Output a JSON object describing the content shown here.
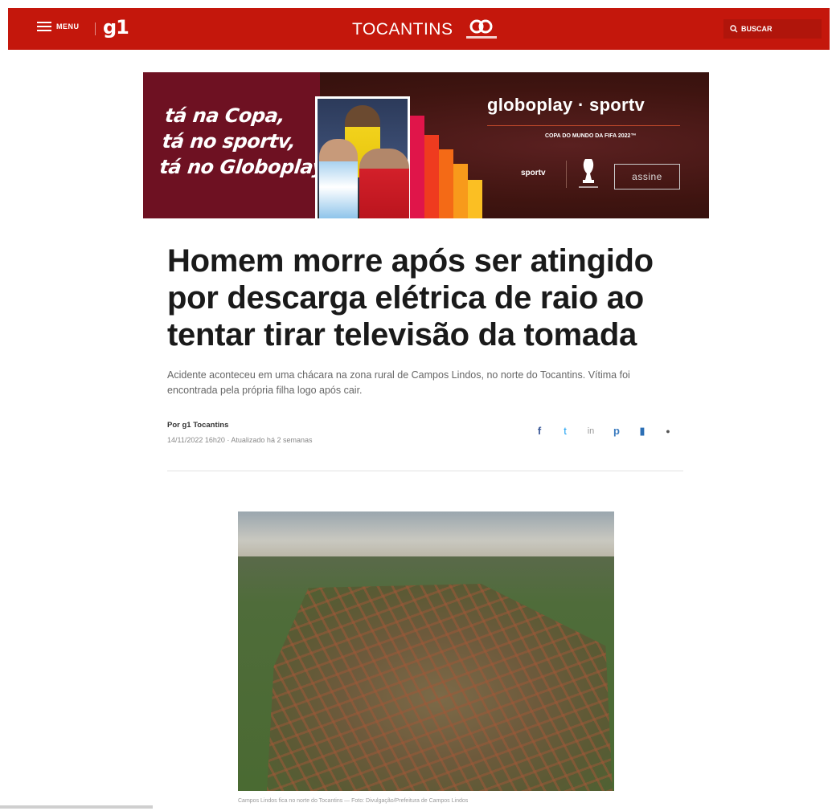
{
  "header": {
    "menu_label": "MENU",
    "logo": "g1",
    "region": "TOCANTINS",
    "search_label": "BUSCAR",
    "brand_color": "#c4170c"
  },
  "ad": {
    "slogan_line1": "tá na Copa,",
    "slogan_line2": "tá no sportv,",
    "slogan_line3": "tá no Globoplay.",
    "brand": "globoplay · sportv",
    "cup_text": "COPA DO MUNDO DA FIFA 2022™",
    "sportv": "sportv",
    "cta": "assine"
  },
  "article": {
    "headline": "Homem morre após ser atingido por descarga elétrica de raio ao tentar tirar televisão da tomada",
    "subtitle": "Acidente aconteceu em uma chácara na zona rural de Campos Lindos, no norte do Tocantins. Vítima foi encontrada pela própria filha logo após cair.",
    "byline": "Por g1 Tocantins",
    "dates": "14/11/2022 16h20 · Atualizado há 2 semanas",
    "share_icons": [
      "facebook-icon",
      "twitter-icon",
      "linkedin-icon",
      "pinterest-icon",
      "whatsapp-icon",
      "telegram-icon"
    ],
    "photo_caption": "Campos Lindos fica no norte do Tocantins — Foto: Divulgação/Prefeitura de Campos Lindos"
  }
}
